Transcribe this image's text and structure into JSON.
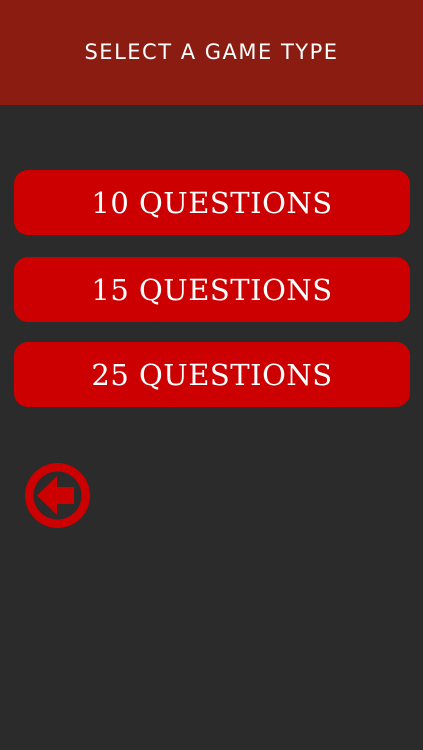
{
  "header": {
    "title": "SELECT A GAME TYPE"
  },
  "options": [
    {
      "label": "10 QUESTIONS"
    },
    {
      "label": "15 QUESTIONS"
    },
    {
      "label": "25 QUESTIONS"
    }
  ],
  "back_button": {
    "icon": "arrow-left-icon"
  },
  "colors": {
    "header_bg": "#8a1c12",
    "background": "#2b2b2b",
    "button_bg": "#cc0000",
    "text": "#ffffff"
  }
}
